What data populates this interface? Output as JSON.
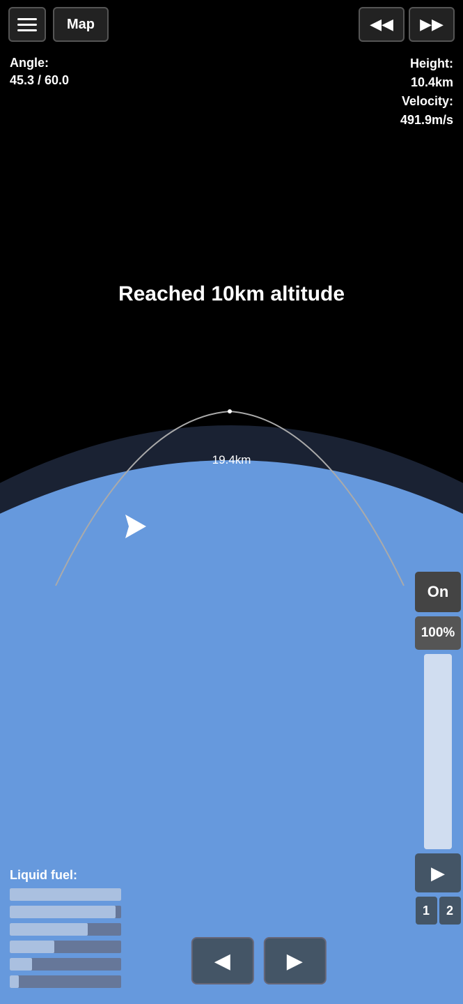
{
  "toolbar": {
    "menu_label": "☰",
    "map_label": "Map",
    "rewind_label": "◀◀",
    "forward_label": "▶▶"
  },
  "hud": {
    "angle_label": "Angle:",
    "angle_value": "45.3 / 60.0",
    "height_label": "Height:",
    "height_value": "10.4km",
    "velocity_label": "Velocity:",
    "velocity_value": "491.9m/s"
  },
  "sim": {
    "altitude_message": "Reached 10km altitude",
    "trajectory_distance": "19.4km"
  },
  "controls": {
    "on_label": "On",
    "percent_label": "100%",
    "play_icon": "▶",
    "num1_label": "1",
    "num2_label": "2"
  },
  "fuel": {
    "label": "Liquid fuel:",
    "bars": [
      100,
      95,
      70,
      40,
      20,
      8
    ]
  },
  "bottom_playback": {
    "rewind_label": "◀",
    "play_label": "▶"
  }
}
